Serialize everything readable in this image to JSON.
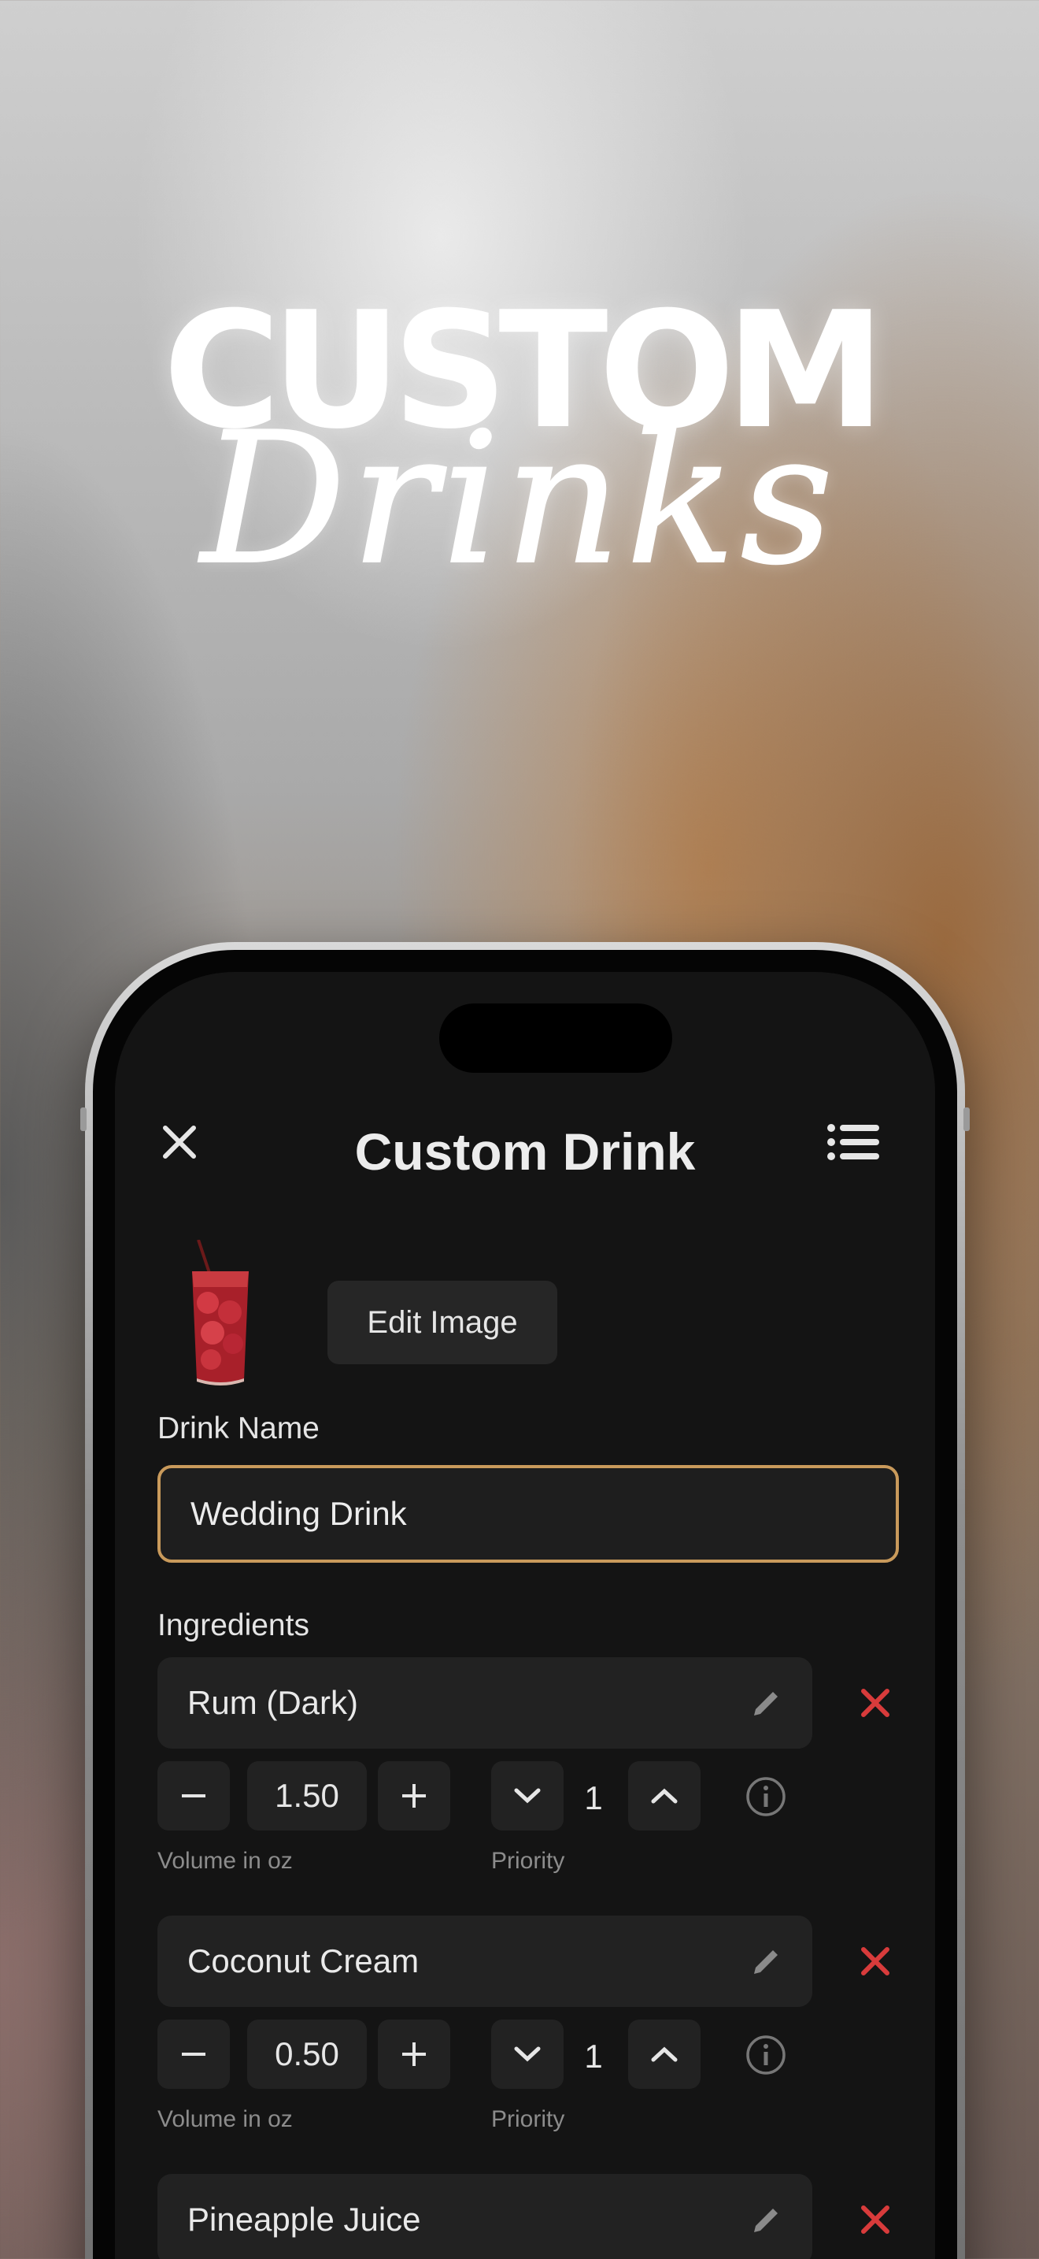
{
  "hero": {
    "title": "CUSTOM",
    "script": "Drinks"
  },
  "nav": {
    "title": "Custom Drink",
    "close_icon": "close-icon",
    "list_icon": "list-icon"
  },
  "image_section": {
    "edit_label": "Edit Image"
  },
  "drink_name": {
    "label": "Drink Name",
    "value": "Wedding Drink"
  },
  "ingredients": {
    "label": "Ingredients",
    "items": [
      {
        "name": "Rum (Dark)",
        "volume": "1.50",
        "priority": "1",
        "volume_label": "Volume in oz",
        "priority_label": "Priority"
      },
      {
        "name": "Coconut Cream",
        "volume": "0.50",
        "priority": "1",
        "volume_label": "Volume in oz",
        "priority_label": "Priority"
      },
      {
        "name": "Pineapple Juice"
      }
    ]
  },
  "colors": {
    "accent": "#c99a5b",
    "remove": "#d83b3b",
    "screen_bg": "#141414",
    "control_bg": "#222222"
  }
}
